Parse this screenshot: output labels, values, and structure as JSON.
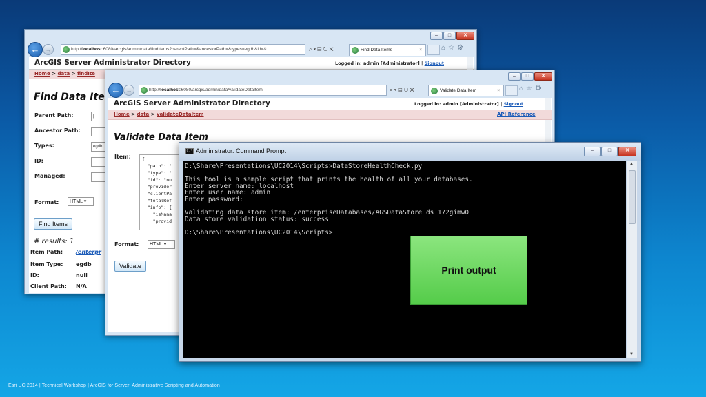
{
  "footer": "Esri UC 2014 | Technical Workshop |  ArcGIS for Server: Administrative Scripting and Automation",
  "win1": {
    "url_prefix": "http://",
    "url_host": "localhost",
    "url_rest": ":6080/arcgis/admin/data/findItems?parentPath=&ancestorPath=&types=egdb&id=&",
    "tab_label": "Find Data Items",
    "site_title": "ArcGIS Server Administrator Directory",
    "login_prefix": "Logged in: admin [Administrator] | ",
    "signout": "Signout",
    "crumb_home": "Home",
    "crumb_sep1": " > ",
    "crumb_data": "data",
    "crumb_sep2": " > ",
    "crumb_current": "findIte",
    "heading": "Find Data Item",
    "labels": {
      "parent_path": "Parent Path:",
      "ancestor_path": "Ancestor Path:",
      "types": "Types:",
      "id": "ID:",
      "managed": "Managed:",
      "format": "Format:"
    },
    "types_value": "egdb",
    "format_value": "HTML",
    "find_button": "Find Items",
    "results": "# results: 1",
    "result_fields": [
      {
        "label": "Item Path:",
        "value": "/enterpr"
      },
      {
        "label": "Item Type:",
        "value": "egdb"
      },
      {
        "label": "ID:",
        "value": "null"
      },
      {
        "label": "Client Path:",
        "value": "N/A"
      }
    ]
  },
  "win2": {
    "url_prefix": "http://",
    "url_host": "localhost",
    "url_rest": ":6080/arcgis/admin/data/validateDataItem",
    "tab_label": "Validate Data Item",
    "site_title": "ArcGIS Server Administrator Directory",
    "login_prefix": "Logged in: admin [Administrator] | ",
    "signout": "Signout",
    "crumb_home": "Home",
    "crumb_sep1": " > ",
    "crumb_data": "data",
    "crumb_sep2": " > ",
    "crumb_current": "validateDataItem",
    "api_reference": "API Reference",
    "heading": "Validate Data Item",
    "item_label": "Item:",
    "item_json": "{\n  \"path\": \"\n  \"type\": \"\n  \"id\": \"nu\n  \"provider\n  \"clientPa\n  \"totalRef\n  \"info\": {\n    \"isMana\n    \"provid",
    "format_label": "Format:",
    "format_value": "HTML",
    "validate_button": "Validate"
  },
  "cmd": {
    "title": "Administrator: Command Prompt",
    "icon_text": "C:\\",
    "lines": [
      "D:\\Share\\Presentations\\UC2014\\Scripts>DataStoreHealthCheck.py",
      "",
      "This tool is a sample script that prints the health of all your databases.",
      "Enter server name: localhost",
      "Enter user name: admin",
      "Enter password:",
      "",
      "Validating data store item: /enterpriseDatabases/AGSDataStore_ds_172gimw0",
      "Data store validation status: success",
      "",
      "D:\\Share\\Presentations\\UC2014\\Scripts>"
    ]
  },
  "callout": "Print output",
  "colors": {
    "console_bg": "#000000",
    "console_text": "#d4d4d4",
    "callout_green": "#6fda62",
    "crumb_bg": "#f2dada"
  }
}
